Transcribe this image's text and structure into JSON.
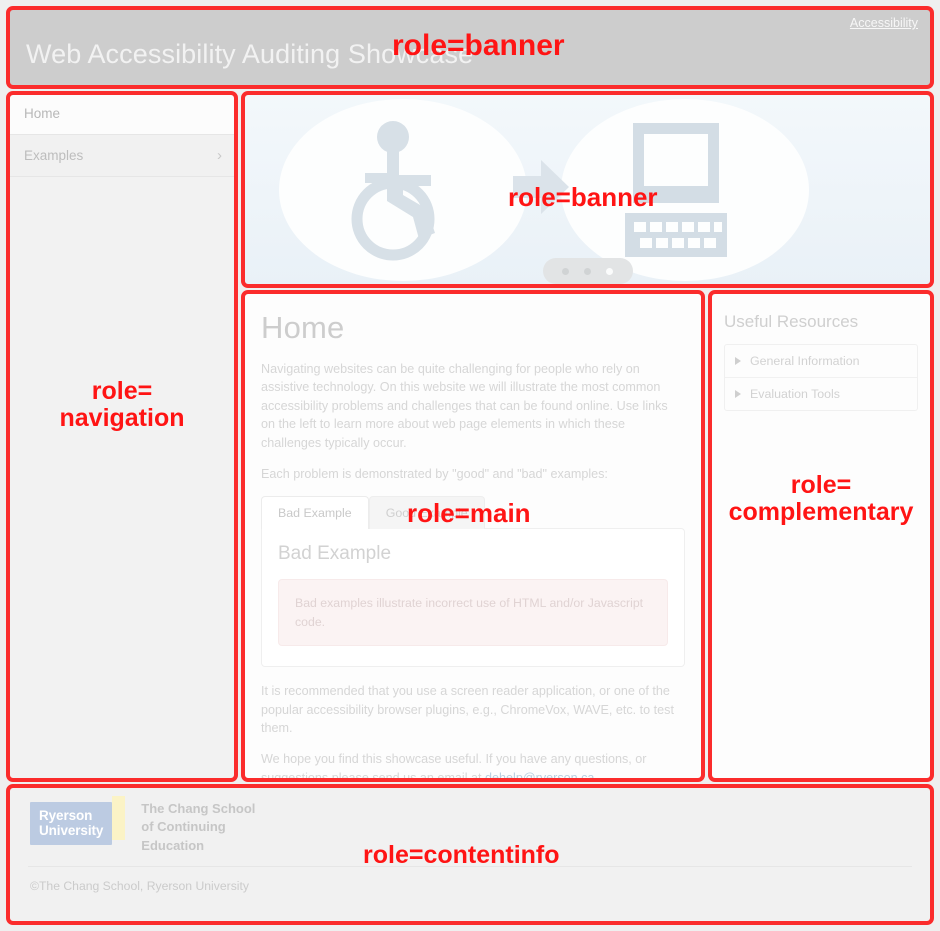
{
  "header": {
    "title": "Web Accessibility Auditing Showcase",
    "accessibility_link": "Accessibility"
  },
  "navigation": {
    "items": [
      {
        "label": "Home",
        "active": true,
        "chevron": ""
      },
      {
        "label": "Examples",
        "active": false,
        "chevron": "›"
      }
    ]
  },
  "banner": {
    "icons": [
      "wheelchair-icon",
      "arrow-right-icon",
      "computer-icon"
    ],
    "carousel_dots": 3,
    "active_dot": 3
  },
  "main": {
    "heading": "Home",
    "paragraph1": "Navigating websites can be quite challenging for people who rely on assistive technology. On this website we will illustrate the most common accessibility problems and challenges that can be found online. Use links on the left to learn more about web page elements in which these challenges typically occur.",
    "paragraph2": "Each problem is demonstrated by \"good\" and \"bad\" examples:",
    "tabs": [
      {
        "label": "Bad Example",
        "active": true
      },
      {
        "label": "Good Example",
        "active": false
      }
    ],
    "panel_title": "Bad Example",
    "alert_text": "Bad examples illustrate incorrect use of HTML and/or Javascript code.",
    "paragraph3": "It is recommended that you use a screen reader application, or one of the popular accessibility browser plugins, e.g., ChromeVox, WAVE, etc. to test them.",
    "paragraph4_pre": "We hope you find this showcase useful. If you have any questions, or suggestions please send us an email at ",
    "email": "dehelp@ryerson.ca"
  },
  "complementary": {
    "heading": "Useful Resources",
    "items": [
      {
        "label": "General Information"
      },
      {
        "label": "Evaluation Tools"
      }
    ]
  },
  "footer": {
    "logo_line1": "Ryerson",
    "logo_line2": "University",
    "chang_line1": "The Chang School",
    "chang_line2": "of Continuing",
    "chang_line3": "Education",
    "copyright": "©The Chang School, Ryerson University"
  },
  "annotations": {
    "banner_header": "role=banner",
    "banner_carousel": "role=banner",
    "navigation": "role=\nnavigation",
    "main": "role=main",
    "complementary": "role=\ncomplementary",
    "contentinfo": "role=contentinfo",
    "color": "#ff1414"
  }
}
